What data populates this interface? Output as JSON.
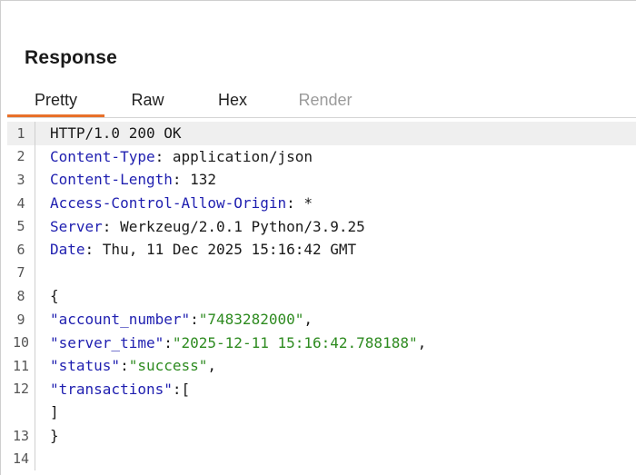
{
  "panel": {
    "title": "Response"
  },
  "tabs": [
    {
      "label": "Pretty",
      "active": true
    },
    {
      "label": "Raw",
      "active": false
    },
    {
      "label": "Hex",
      "active": false
    },
    {
      "label": "Render",
      "active": false,
      "disabled": true
    }
  ],
  "colors": {
    "accent": "#e8702a",
    "header_key": "#1f1fb0",
    "json_string_value": "#2e8b20",
    "highlight_row": "#efefef"
  },
  "response": {
    "status_line": "HTTP/1.0 200 OK",
    "headers": [
      {
        "name": "Content-Type",
        "value": "application/json"
      },
      {
        "name": "Content-Length",
        "value": "132"
      },
      {
        "name": "Access-Control-Allow-Origin",
        "value": "*"
      },
      {
        "name": "Server",
        "value": "Werkzeug/2.0.1 Python/3.9.25"
      },
      {
        "name": "Date",
        "value": "Thu, 11 Dec 2025 15:16:42 GMT"
      }
    ],
    "body": {
      "open_brace": "{",
      "fields": [
        {
          "key": "\"account_number\"",
          "value": "\"7483282000\"",
          "trail": ","
        },
        {
          "key": "\"server_time\"",
          "value": "\"2025-12-11 15:16:42.788188\"",
          "trail": ","
        },
        {
          "key": "\"status\"",
          "value": "\"success\"",
          "trail": ","
        },
        {
          "key": "\"transactions\"",
          "value": "[",
          "trail": ""
        }
      ],
      "array_close": "]",
      "close_brace": "}"
    }
  },
  "line_numbers": [
    "1",
    "2",
    "3",
    "4",
    "5",
    "6",
    "7",
    "8",
    "9",
    "10",
    "11",
    "12",
    "13",
    "14"
  ]
}
